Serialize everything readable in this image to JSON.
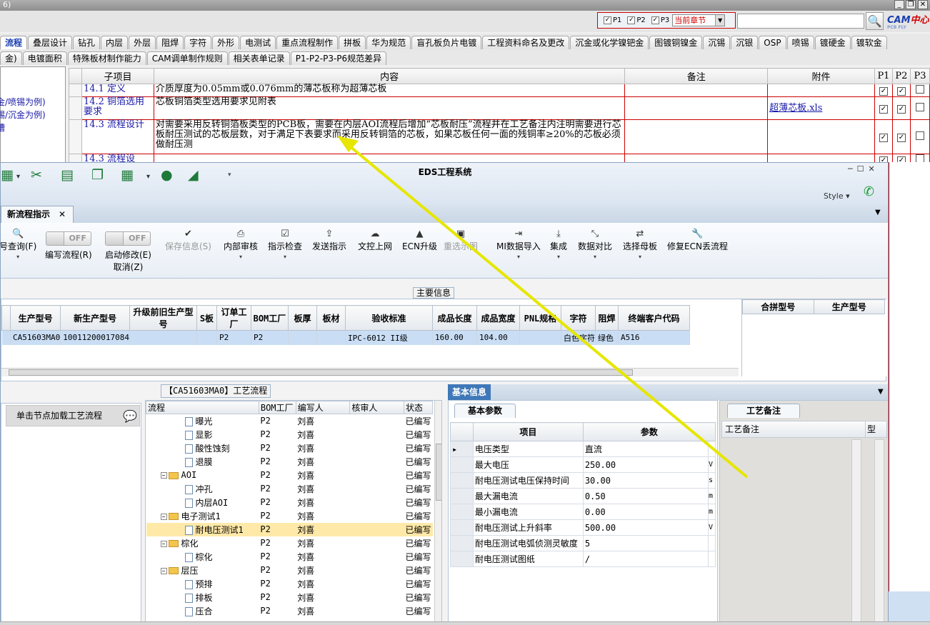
{
  "window": {
    "title": "6)"
  },
  "filter": {
    "p1": "P1",
    "p2": "P2",
    "p3": "P3",
    "chapter": "当前章节"
  },
  "logo": {
    "cam": "CAM",
    "center": "中心",
    "sub": "PCB FLY"
  },
  "tabs_row1": [
    "流程",
    "叠层设计",
    "钻孔",
    "内层",
    "外层",
    "阻焊",
    "字符",
    "外形",
    "电测试",
    "重点流程制作",
    "拼板",
    "华为规范",
    "盲孔板负片电镀",
    "工程资料命名及更改",
    "沉金或化学镍钯金",
    "图镀铜镍金",
    "沉锡",
    "沉银",
    "OSP",
    "喷锡",
    "镀硬金",
    "镀软金"
  ],
  "tabs_row2": [
    "金)",
    "电镀面积",
    "特殊板材制作能力",
    "CAM调单制作规则",
    "相关表单记录",
    "P1-P2-P3-P6规范差异"
  ],
  "doc_left": {
    "line1": "金/喷锡为例)",
    "line2": "锡/沉金为例)",
    "line3": "槽"
  },
  "doc_table": {
    "headers": [
      "子项目",
      "内容",
      "备注",
      "附件",
      "P1",
      "P2",
      "P3"
    ],
    "rows": [
      {
        "sub": "14.1 定义",
        "content": "介质厚度为0.05mm或0.076mm的薄芯板称为超薄芯板",
        "note": "",
        "attach": "",
        "p1": true,
        "p2": true,
        "p3": false
      },
      {
        "sub": "14.2 铜箔选用要求",
        "content": "芯板铜箔类型选用要求见附表",
        "note": "",
        "attach": "超薄芯板.xls",
        "p1": true,
        "p2": true,
        "p3": false
      },
      {
        "sub": "14.3 流程设计",
        "content": "对需要采用反转铜箔板类型的PCB板，需要在内层AOI流程后增加“芯板耐压”流程并在工艺备注内注明需要进行芯板耐压测试的芯板层数，对于满足下表要求而采用反转铜箔的芯板，如果芯板任何一面的残铜率≥20%的芯板必须做耐压测",
        "note": "",
        "attach": "",
        "p1": true,
        "p2": true,
        "p3": false
      },
      {
        "sub": "14.3 流程设",
        "content": "",
        "note": "",
        "attach": "",
        "p1": true,
        "p2": true,
        "p3": false
      }
    ]
  },
  "eds": {
    "title": "EDS工程系统",
    "style_label": "Style",
    "tab_label": "新流程指示",
    "ribbon": {
      "query": "号查询(F)",
      "toggle_off": "OFF",
      "write_flow": "编写流程(R)",
      "start_modify": "启动修改(E)",
      "cancel": "取消(Z)",
      "save_info": "保存信息(S)",
      "internal_review": "内部审核",
      "instruction_check": "指示检查",
      "send_instruction": "发送指示",
      "upload": "文控上网",
      "ecn_upgrade": "ECN升级",
      "reselect_image": "重选示图",
      "mi_import": "MI数据导入",
      "integrate": "集成",
      "data_compare": "数据对比",
      "select_master": "选择母板",
      "fix_ecn": "修复ECN丢流程"
    },
    "main_info": {
      "label": "主要信息",
      "headers": [
        "生产型号",
        "新生产型号",
        "升级前旧生产型号",
        "S板",
        "订单工厂",
        "BOM工厂",
        "板厚",
        "板材",
        "验收标准",
        "成品长度",
        "成品宽度",
        "PNL规格",
        "字符",
        "阻焊",
        "终端客户代码"
      ],
      "row": [
        "CA51603MA0",
        "10011200017084",
        "",
        "",
        "P2",
        "P2",
        "",
        "",
        "IPC-6012 II级",
        "160.00",
        "104.00",
        "",
        "白色字符",
        "绿色",
        "A516"
      ],
      "merge_headers": [
        "合拼型号",
        "生产型号"
      ]
    },
    "node_panel": {
      "button": "单击节点加载工艺流程"
    },
    "flow": {
      "caption": "【CA51603MA0】工艺流程",
      "headers": [
        "流程",
        "BOM工厂",
        "编写人",
        "核审人",
        "状态"
      ],
      "rows": [
        {
          "name": "曝光",
          "folder": false,
          "bom": "P2",
          "writer": "刘喜",
          "status": "已编写"
        },
        {
          "name": "显影",
          "folder": false,
          "bom": "P2",
          "writer": "刘喜",
          "status": "已编写"
        },
        {
          "name": "酸性蚀刻",
          "folder": false,
          "bom": "P2",
          "writer": "刘喜",
          "status": "已编写"
        },
        {
          "name": "退膜",
          "folder": false,
          "bom": "P2",
          "writer": "刘喜",
          "status": "已编写"
        },
        {
          "name": "AOI",
          "folder": true,
          "bom": "P2",
          "writer": "刘喜",
          "status": "已编写"
        },
        {
          "name": "冲孔",
          "folder": false,
          "bom": "P2",
          "writer": "刘喜",
          "status": "已编写"
        },
        {
          "name": "内层AOI",
          "folder": false,
          "bom": "P2",
          "writer": "刘喜",
          "status": "已编写"
        },
        {
          "name": "电子测试1",
          "folder": true,
          "bom": "P2",
          "writer": "刘喜",
          "status": "已编写"
        },
        {
          "name": "耐电压测试1",
          "folder": false,
          "bom": "P2",
          "writer": "刘喜",
          "status": "已编写"
        },
        {
          "name": "棕化",
          "folder": true,
          "bom": "P2",
          "writer": "刘喜",
          "status": "已编写"
        },
        {
          "name": "棕化",
          "folder": false,
          "bom": "P2",
          "writer": "刘喜",
          "status": "已编写"
        },
        {
          "name": "层压",
          "folder": true,
          "bom": "P2",
          "writer": "刘喜",
          "status": "已编写"
        },
        {
          "name": "预排",
          "folder": false,
          "bom": "P2",
          "writer": "刘喜",
          "status": "已编写"
        },
        {
          "name": "排板",
          "folder": false,
          "bom": "P2",
          "writer": "刘喜",
          "status": "已编写"
        },
        {
          "name": "压合",
          "folder": false,
          "bom": "P2",
          "writer": "刘喜",
          "status": "已编写"
        }
      ],
      "selected_index": 8
    },
    "basic": {
      "tab": "基本信息",
      "params_tab": "基本参数",
      "headers": [
        "项目",
        "参数"
      ],
      "rows": [
        {
          "item": "电压类型",
          "value": "直流",
          "unit": ""
        },
        {
          "item": "最大电压",
          "value": "250.00",
          "unit": "V"
        },
        {
          "item": "耐电压测试电压保持时间",
          "value": "30.00",
          "unit": "s"
        },
        {
          "item": "最大漏电流",
          "value": "0.50",
          "unit": "m"
        },
        {
          "item": "最小漏电流",
          "value": "0.00",
          "unit": "m"
        },
        {
          "item": "耐电压测试上升斜率",
          "value": "500.00",
          "unit": "V"
        },
        {
          "item": "耐电压测试电弧侦测灵敏度",
          "value": "5",
          "unit": ""
        },
        {
          "item": "耐电压测试图纸",
          "value": "/",
          "unit": ""
        }
      ],
      "notes_tab": "工艺备注",
      "notes_header": "工艺备注",
      "notes_col2": "型"
    }
  },
  "colors": {
    "accent": "#1a3fb0",
    "table_border": "#cc0000",
    "selected_row": "#ffe9a8",
    "arrow": "#e6e600"
  }
}
